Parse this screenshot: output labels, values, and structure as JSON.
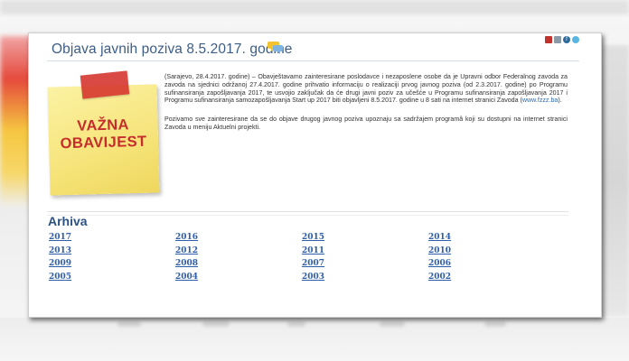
{
  "header": {
    "title": "Objava javnih poziva 8.5.2017. godine"
  },
  "toolbar": {
    "icons": [
      "pdf-icon",
      "print-icon",
      "facebook-icon",
      "twitter-icon"
    ],
    "fb_glyph": "f"
  },
  "note": {
    "line1": "VAŽNA",
    "line2": "OBAVIJEST"
  },
  "article": {
    "paragraph1": "(Sarajevo, 28.4.2017. godine) – Obavještavamo zainteresirane poslodavce i nezaposlene osobe da je Upravni odbor Federalnog zavoda za zavoda na sjednici održanoj 27.4.2017. godine prihvatio informaciju o realizaciji prvog javnog poziva (od 2.3.2017. godine) po Programu sufinansiranja zapošljavanja 2017, te usvojio zaključak da će drugi javni poziv za učešće u Programu sufinansiranja zapošljavanja 2017 i Programu sufinansiranja samozapošljavanja Start up 2017 biti objavljeni 8.5.2017. godine u 8 sati na internet stranici Zavoda (",
    "paragraph1_link": "www.fzzz.ba",
    "paragraph1_end": ").",
    "paragraph2": "Pozivamo sve zainteresirane da se do objave drugog javnog poziva upoznaju sa sadržajem programâ koji su dostupni na internet stranici Zavoda u meniju Aktuelni projekti."
  },
  "archive": {
    "title": "Arhiva",
    "years": [
      "2017",
      "2016",
      "2015",
      "2014",
      "2013",
      "2012",
      "2011",
      "2010",
      "2009",
      "2008",
      "2007",
      "2006",
      "2005",
      "2004",
      "2003",
      "2002"
    ]
  },
  "colors": {
    "title": "#3c5d86",
    "note_text": "#c62c2c",
    "tape": "#d6322b",
    "link": "#2f5ea8"
  }
}
